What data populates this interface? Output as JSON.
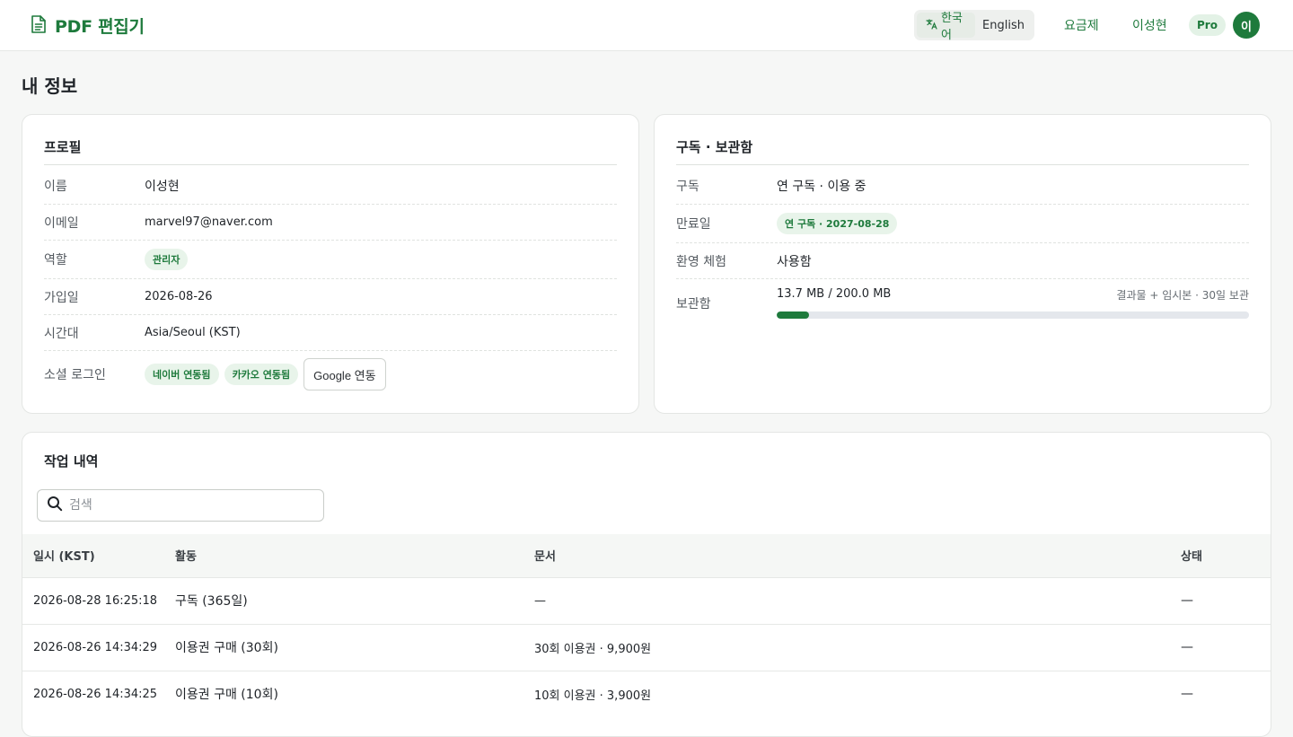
{
  "header": {
    "brand": "PDF 편집기",
    "lang_active": "한국어",
    "lang_inactive": "English",
    "pricing": "요금제",
    "username": "이성현",
    "plan_badge": "Pro",
    "avatar_initial": "이",
    "accent_color": "#1e7a3c"
  },
  "page": {
    "title": "내 정보"
  },
  "profile": {
    "title": "프로필",
    "name_label": "이름",
    "name": "이성현",
    "email_label": "이메일",
    "email": "marvel97@naver.com",
    "role_label": "역할",
    "role": "관리자",
    "joined_label": "가입일",
    "joined": "2026-08-26",
    "tz_label": "시간대",
    "tz": "Asia/Seoul (KST)",
    "social_label": "소셜 로그인",
    "naver": "네이버 연동됨",
    "kakao": "카카오 연동됨",
    "google_button": "Google 연동"
  },
  "subscription": {
    "title": "구독 · 보관함",
    "sub_label": "구독",
    "sub": "연 구독 · 이용 중",
    "expiry_label": "만료일",
    "expiry": "연 구독 · 2027-08-28",
    "trial_label": "환영 체험",
    "trial": "사용함",
    "storage_label": "보관함",
    "storage_usage": "13.7 MB / 200.0 MB",
    "storage_note": "결과물 + 임시본 · 30일 보관",
    "storage_fraction": 0.0685
  },
  "activity": {
    "title": "작업 내역",
    "search_placeholder": "검색",
    "columns": {
      "time": "일시 (KST)",
      "activity": "활동",
      "document": "문서",
      "status": "상태"
    },
    "rows": [
      {
        "time": "2026-08-28 16:25:18",
        "activity": "구독 (365일)",
        "document": "—",
        "status": "—"
      },
      {
        "time": "2026-08-26 14:34:29",
        "activity": "이용권 구매 (30회)",
        "document": "30회 이용권 · 9,900원",
        "status": "—"
      },
      {
        "time": "2026-08-26 14:34:25",
        "activity": "이용권 구매 (10회)",
        "document": "10회 이용권 · 3,900원",
        "status": "—"
      }
    ]
  }
}
